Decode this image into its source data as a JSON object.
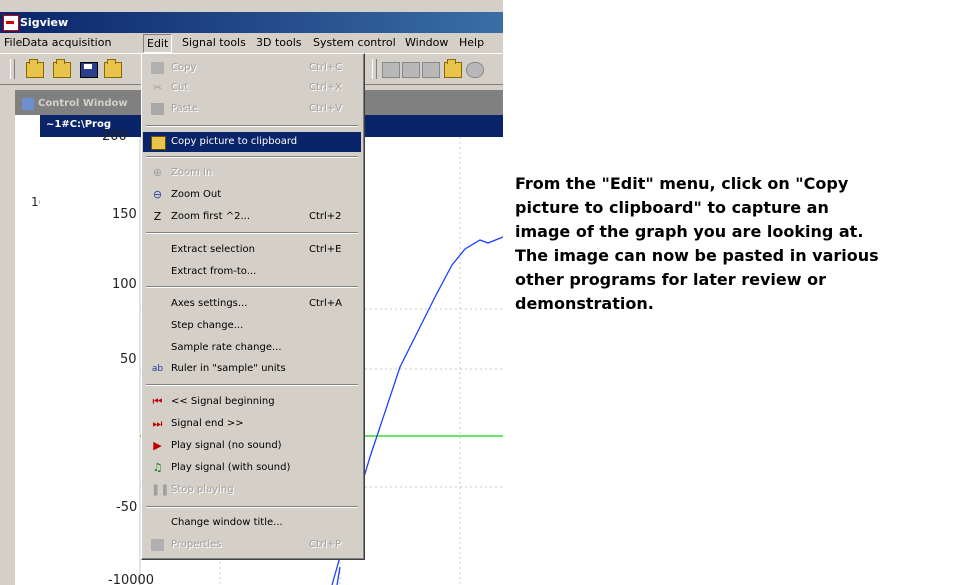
{
  "window": {
    "title": "Sigview"
  },
  "menubar": [
    "File",
    "Data acquisition",
    "Edit",
    "Signal tools",
    "3D tools",
    "System control",
    "Window",
    "Help"
  ],
  "control_window": {
    "title": "Control Window"
  },
  "plot_window": {
    "title": "~1#C:\\Prog"
  },
  "plot": {
    "left_label": "1(",
    "y_ticks": [
      "200",
      "150",
      "100",
      "50",
      "-50",
      "-10000"
    ],
    "colors": {
      "signal": "#1f3fff",
      "zero_line": "#33dd33",
      "grid": "#c8c8c8"
    }
  },
  "edit_menu": {
    "items": [
      {
        "label": "Copy",
        "shortcut": "Ctrl+C",
        "icon": "copy-icon",
        "enabled": false
      },
      {
        "label": "Cut",
        "shortcut": "Ctrl+X",
        "icon": "cut-icon",
        "enabled": false
      },
      {
        "label": "Paste",
        "shortcut": "Ctrl+V",
        "icon": "paste-icon",
        "enabled": false
      },
      {
        "label": "Copy picture to clipboard",
        "shortcut": "",
        "icon": "picture-icon",
        "enabled": true,
        "selected": true
      },
      {
        "label": "Zoom In",
        "shortcut": "",
        "icon": "zoom-in-icon",
        "enabled": false
      },
      {
        "label": "Zoom Out",
        "shortcut": "",
        "icon": "zoom-out-icon",
        "enabled": true
      },
      {
        "label": "Zoom first ^2...",
        "shortcut": "Ctrl+2",
        "icon": "zoom-first-icon",
        "enabled": true
      },
      {
        "label": "Extract selection",
        "shortcut": "Ctrl+E",
        "icon": "",
        "enabled": true
      },
      {
        "label": "Extract from-to...",
        "shortcut": "",
        "icon": "",
        "enabled": true
      },
      {
        "label": "Axes settings...",
        "shortcut": "Ctrl+A",
        "icon": "",
        "enabled": true
      },
      {
        "label": "Step change...",
        "shortcut": "",
        "icon": "",
        "enabled": true
      },
      {
        "label": "Sample rate change...",
        "shortcut": "",
        "icon": "",
        "enabled": true
      },
      {
        "label": "Ruler in \"sample\" units",
        "shortcut": "",
        "icon": "ruler-icon",
        "enabled": true
      },
      {
        "label": "<< Signal beginning",
        "shortcut": "",
        "icon": "signal-beginning-icon",
        "enabled": true
      },
      {
        "label": "Signal end >>",
        "shortcut": "",
        "icon": "signal-end-icon",
        "enabled": true
      },
      {
        "label": "Play signal (no sound)",
        "shortcut": "",
        "icon": "play-icon",
        "enabled": true
      },
      {
        "label": "Play signal (with sound)",
        "shortcut": "",
        "icon": "play-sound-icon",
        "enabled": true
      },
      {
        "label": "Stop playing",
        "shortcut": "",
        "icon": "stop-icon",
        "enabled": false
      },
      {
        "label": "Change window title...",
        "shortcut": "",
        "icon": "",
        "enabled": true
      },
      {
        "label": "Properties",
        "shortcut": "Ctrl+P",
        "icon": "properties-icon",
        "enabled": false
      }
    ]
  },
  "note": {
    "lines": [
      "From the \"Edit\" menu, click on \"Copy",
      "picture to clipboard\" to capture an",
      "image of the graph you are looking at.",
      "The image can now be pasted in various",
      "other programs for later review or",
      "demonstration."
    ]
  }
}
